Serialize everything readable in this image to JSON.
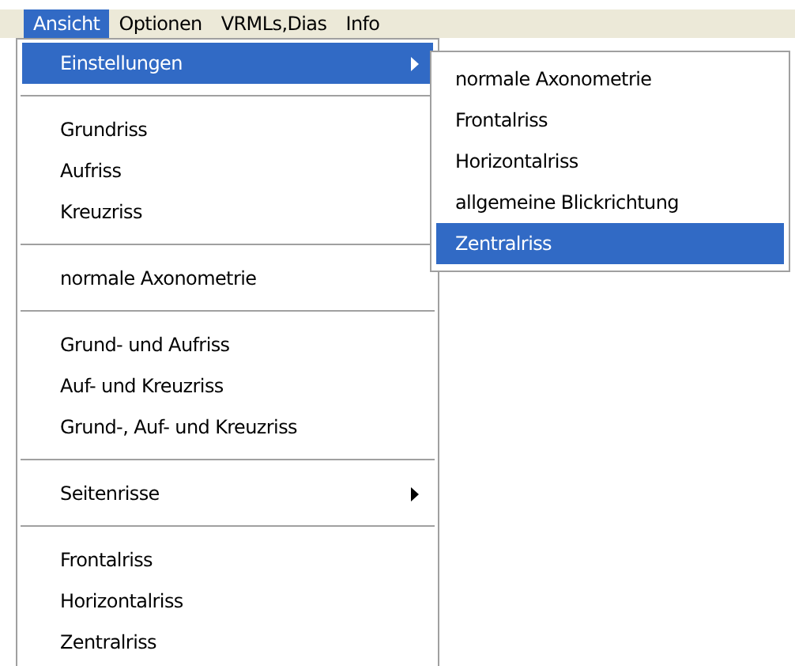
{
  "menubar": [
    {
      "label": "Ansicht",
      "selected": true
    },
    {
      "label": "Optionen",
      "selected": false
    },
    {
      "label": "VRMLs,Dias",
      "selected": false
    },
    {
      "label": "Info",
      "selected": false
    }
  ],
  "menu": [
    {
      "kind": "item",
      "label": "Einstellungen",
      "submenu": true,
      "selected": true
    },
    {
      "kind": "separator"
    },
    {
      "kind": "item",
      "label": "Grundriss",
      "submenu": false,
      "selected": false
    },
    {
      "kind": "item",
      "label": "Aufriss",
      "submenu": false,
      "selected": false
    },
    {
      "kind": "item",
      "label": "Kreuzriss",
      "submenu": false,
      "selected": false
    },
    {
      "kind": "separator"
    },
    {
      "kind": "item",
      "label": "normale Axonometrie",
      "submenu": false,
      "selected": false
    },
    {
      "kind": "separator"
    },
    {
      "kind": "item",
      "label": "Grund- und Aufriss",
      "submenu": false,
      "selected": false
    },
    {
      "kind": "item",
      "label": "Auf- und Kreuzriss",
      "submenu": false,
      "selected": false
    },
    {
      "kind": "item",
      "label": "Grund-, Auf- und Kreuzriss",
      "submenu": false,
      "selected": false
    },
    {
      "kind": "separator"
    },
    {
      "kind": "item",
      "label": "Seitenrisse",
      "submenu": true,
      "selected": false
    },
    {
      "kind": "separator"
    },
    {
      "kind": "item",
      "label": "Frontalriss",
      "submenu": false,
      "selected": false
    },
    {
      "kind": "item",
      "label": "Horizontalriss",
      "submenu": false,
      "selected": false
    },
    {
      "kind": "item",
      "label": "Zentralriss",
      "submenu": false,
      "selected": false
    }
  ],
  "submenu": [
    {
      "label": "normale Axonometrie",
      "selected": false
    },
    {
      "label": "Frontalriss",
      "selected": false
    },
    {
      "label": "Horizontalriss",
      "selected": false
    },
    {
      "label": "allgemeine Blickrichtung",
      "selected": false
    },
    {
      "label": "Zentralriss",
      "selected": true
    }
  ]
}
